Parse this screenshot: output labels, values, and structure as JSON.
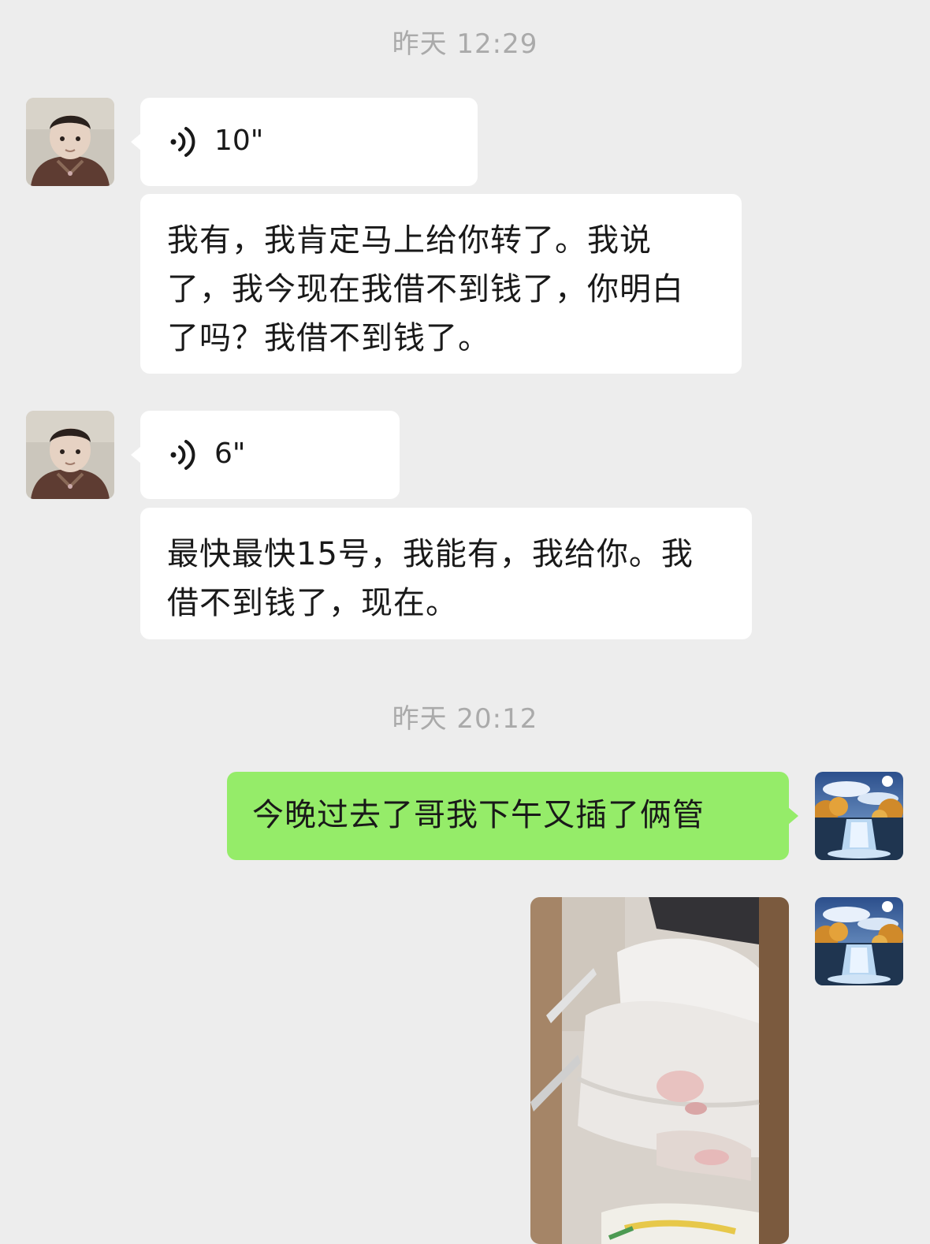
{
  "timestamps": {
    "first": "昨天 12:29",
    "second": "昨天 20:12"
  },
  "messages": [
    {
      "sender": "contact",
      "type": "voice",
      "duration": "10\""
    },
    {
      "sender": "contact",
      "type": "text",
      "text": "我有，我肯定马上给你转了。我说了，我今现在我借不到钱了，你明白了吗？我借不到钱了。"
    },
    {
      "sender": "contact",
      "type": "voice",
      "duration": "6\""
    },
    {
      "sender": "contact",
      "type": "text",
      "text": "最快最快15号，我能有，我给你。我借不到钱了，现在。"
    },
    {
      "sender": "me",
      "type": "text",
      "text": "今晚过去了哥我下午又插了俩管"
    },
    {
      "sender": "me",
      "type": "image"
    }
  ],
  "colors": {
    "background": "#ededed",
    "incoming_bubble": "#ffffff",
    "outgoing_bubble": "#95ec69",
    "timestamp_text": "#aaaaaa",
    "message_text": "#191919"
  },
  "icons": {
    "voice": "voice-wave-icon",
    "contact_avatar": "baby-photo-avatar",
    "user_avatar": "waterfall-landscape-avatar"
  }
}
